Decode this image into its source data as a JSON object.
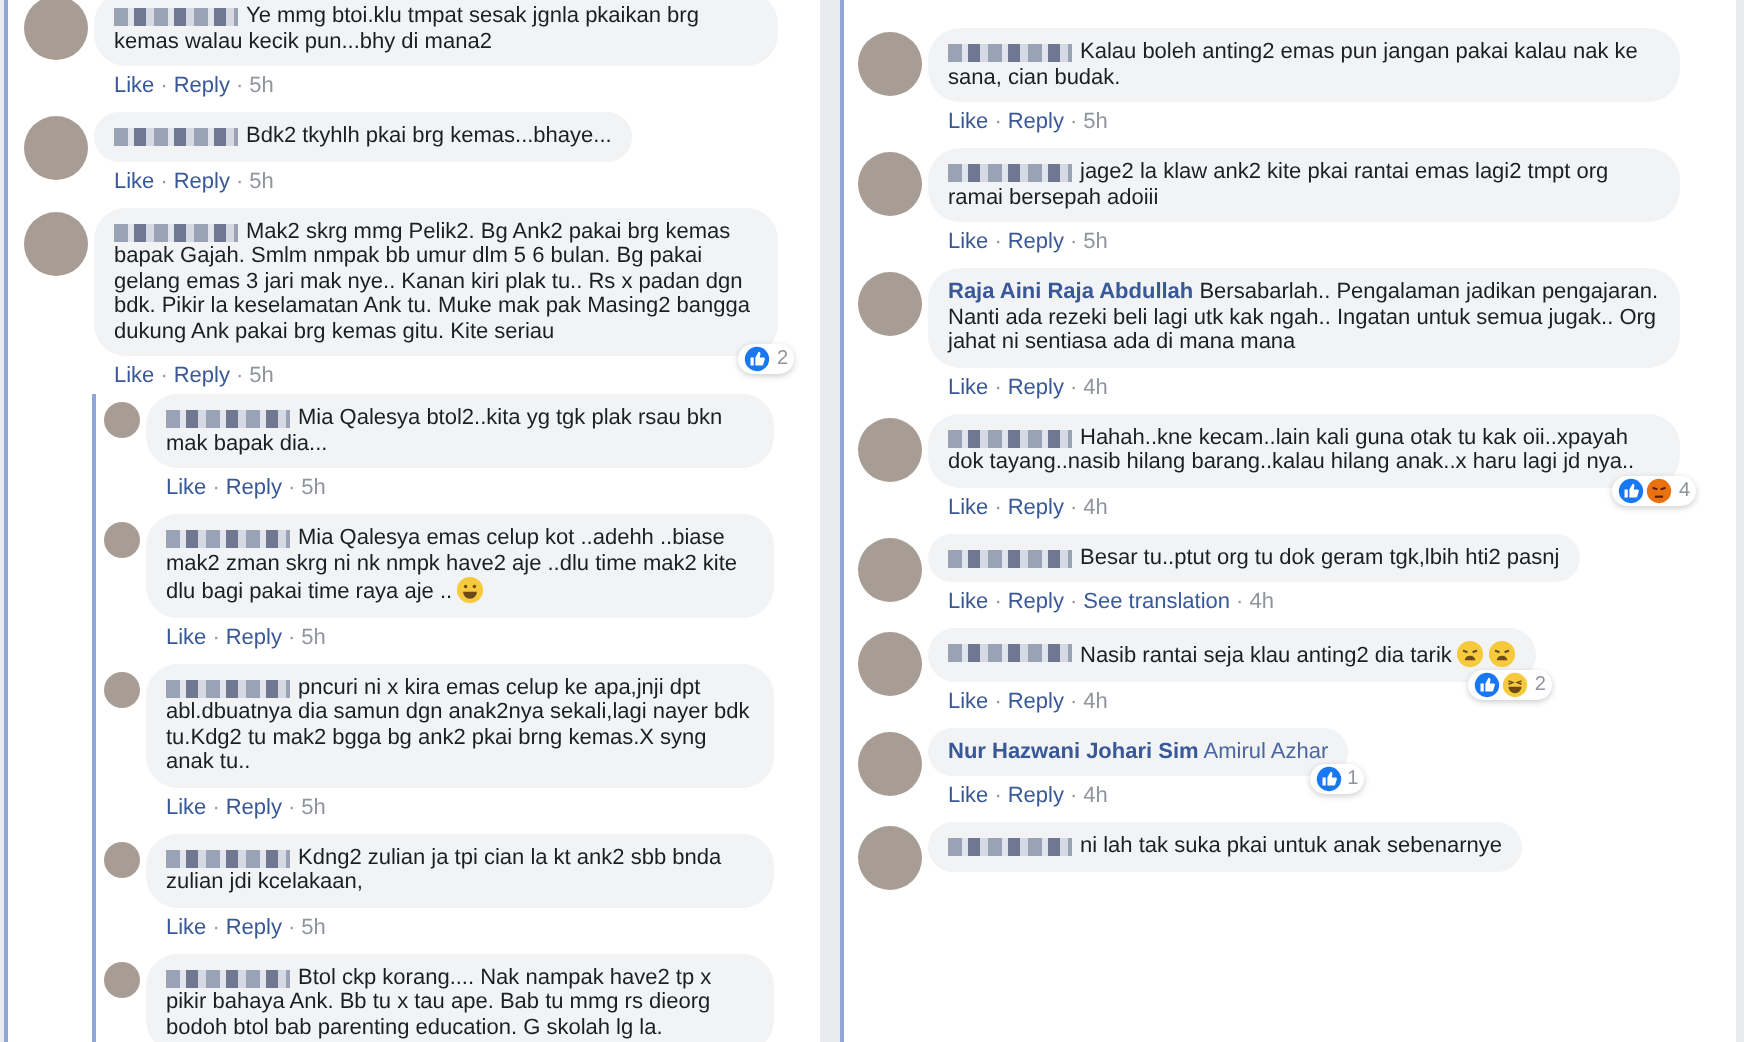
{
  "separator": "·",
  "left_panel": {
    "comments": [
      {
        "name_hidden": true,
        "text": "Ye mmg btoi.klu tmpat sesak jgnla pkaikan brg kemas walau kecik pun...bhy di mana2",
        "actions": [
          "Like",
          "Reply"
        ],
        "time": "5h"
      },
      {
        "name_hidden": true,
        "text": "Bdk2 tkyhlh pkai brg kemas...bhaye...",
        "actions": [
          "Like",
          "Reply"
        ],
        "time": "5h"
      },
      {
        "name_hidden": true,
        "text": "Mak2 skrg mmg Pelik2. Bg Ank2 pakai brg kemas bapak Gajah. Smlm nmpak bb umur dlm 5 6 bulan. Bg pakai gelang emas 3 jari mak nye.. Kanan kiri plak tu.. Rs x padan dgn bdk. Pikir la keselamatan Ank tu. Muke mak pak Masing2 bangga dukung Ank pakai brg kemas gitu. Kite seriau",
        "actions": [
          "Like",
          "Reply"
        ],
        "time": "5h",
        "reactions": {
          "icons": [
            {
              "kind": "like"
            }
          ],
          "count": "2"
        },
        "replies": [
          {
            "name_hidden": true,
            "text": "Mia Qalesya btol2..kita yg tgk plak rsau bkn mak bapak dia...",
            "actions": [
              "Like",
              "Reply"
            ],
            "time": "5h"
          },
          {
            "name_hidden": true,
            "text": "Mia Qalesya emas celup kot ..adehh ..biase mak2 zman skrg ni nk nmpk have2 aje ..dlu time mak2 kite dlu bagi pakai time raya aje ..",
            "emoji": [
              {
                "kind": "grin"
              }
            ],
            "actions": [
              "Like",
              "Reply"
            ],
            "time": "5h"
          },
          {
            "name_hidden": true,
            "text": "pncuri ni x kira emas celup ke apa,jnji dpt abl.dbuatnya dia samun dgn anak2nya sekali,lagi nayer bdk tu.Kdg2 tu mak2 bgga bg ank2 pkai brng kemas.X syng anak tu..",
            "actions": [
              "Like",
              "Reply"
            ],
            "time": "5h"
          },
          {
            "name_hidden": true,
            "text": "Kdng2 zulian ja tpi cian la kt ank2 sbb bnda zulian jdi kcelakaan,",
            "actions": [
              "Like",
              "Reply"
            ],
            "time": "5h"
          },
          {
            "name_hidden": true,
            "text": "Btol ckp korang.... Nak nampak have2 tp x pikir bahaya Ank. Bb tu x tau ape. Bab tu mmg rs dieorg bodoh btol bab parenting education. G skolah lg la."
          }
        ]
      }
    ]
  },
  "right_panel": {
    "comments": [
      {
        "name_hidden": true,
        "text": "Kalau boleh anting2 emas pun jangan pakai kalau nak ke sana, cian budak.",
        "actions": [
          "Like",
          "Reply"
        ],
        "time": "5h"
      },
      {
        "name_hidden": true,
        "text": "jage2 la klaw ank2 kite pkai rantai emas lagi2 tmpt org ramai bersepah adoiii",
        "actions": [
          "Like",
          "Reply"
        ],
        "time": "5h"
      },
      {
        "name_hidden": false,
        "author": "Raja Aini Raja Abdullah",
        "text": "Bersabarlah.. Pengalaman jadikan pengajaran. Nanti ada rezeki beli lagi utk kak ngah.. Ingatan untuk semua jugak.. Org jahat ni sentiasa ada di mana mana",
        "actions": [
          "Like",
          "Reply"
        ],
        "time": "4h"
      },
      {
        "name_hidden": true,
        "text": "Hahah..kne kecam..lain kali guna otak tu kak oii..xpayah dok tayang..nasib hilang barang..kalau hilang anak..x haru lagi jd nya..",
        "actions": [
          "Like",
          "Reply"
        ],
        "time": "4h",
        "reactions": {
          "icons": [
            {
              "kind": "like"
            },
            {
              "kind": "angry"
            }
          ],
          "count": "4"
        }
      },
      {
        "name_hidden": true,
        "text": "Besar tu..ptut org tu dok geram tgk,lbih hti2 pasnj",
        "actions": [
          "Like",
          "Reply",
          "See translation"
        ],
        "time": "4h"
      },
      {
        "name_hidden": true,
        "text": "Nasib rantai seja klau anting2 dia tarik",
        "emoji": [
          {
            "kind": "weary"
          },
          {
            "kind": "weary"
          }
        ],
        "actions": [
          "Like",
          "Reply"
        ],
        "time": "4h",
        "reactions": {
          "icons": [
            {
              "kind": "like"
            },
            {
              "kind": "haha"
            }
          ],
          "count": "2"
        }
      },
      {
        "name_hidden": false,
        "author": "Nur Hazwani Johari Sim",
        "mention": "Amirul Azhar",
        "actions": [
          "Like",
          "Reply"
        ],
        "time": "4h",
        "reactions": {
          "icons": [
            {
              "kind": "like"
            }
          ],
          "count": "1"
        }
      },
      {
        "name_hidden": true,
        "text": "ni lah tak suka pkai untuk anak sebenarnye"
      }
    ]
  }
}
